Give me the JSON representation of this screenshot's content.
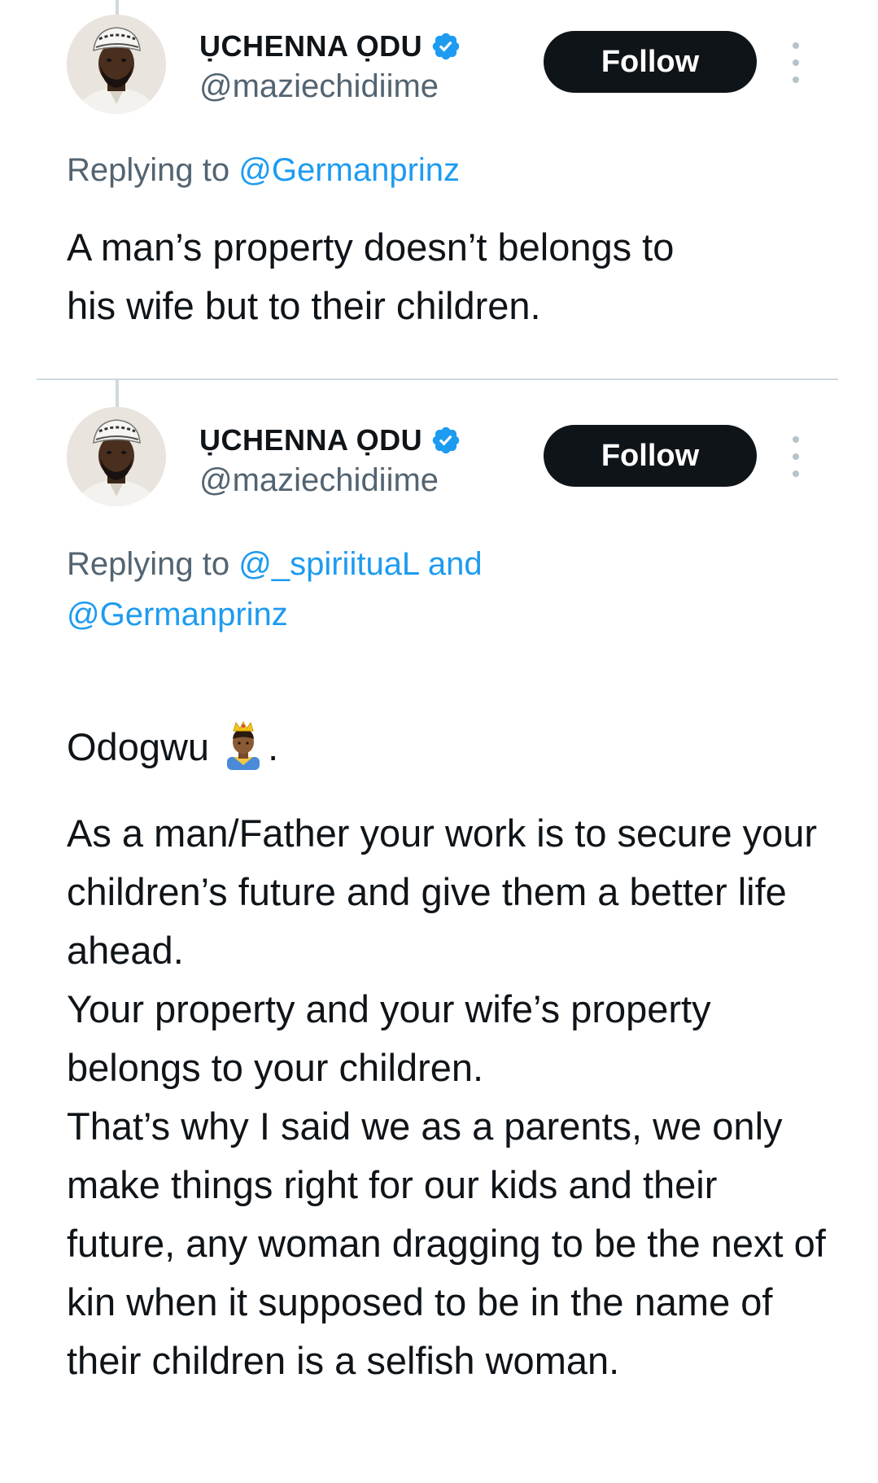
{
  "tweets": [
    {
      "author": {
        "display_name": "ỤCHENNA ỌDU",
        "handle": "@maziechidiime",
        "verified": true,
        "avatar_icon": "profile-photo-man-with-cap"
      },
      "follow_label": "Follow",
      "more_icon": "vertical-ellipsis-icon",
      "replying_prefix": "Replying to",
      "replying_to": [
        "@Germanprinz"
      ],
      "text": "A man’s property doesn’t belongs to his wife but to their children."
    },
    {
      "author": {
        "display_name": "ỤCHENNA ỌDU",
        "handle": "@maziechidiime",
        "verified": true,
        "avatar_icon": "profile-photo-man-with-cap"
      },
      "follow_label": "Follow",
      "more_icon": "vertical-ellipsis-icon",
      "replying_prefix": "Replying to",
      "replying_to": [
        "@_spiriituaL",
        "and",
        "@Germanprinz"
      ],
      "text_lead": "Odogwu",
      "text_lead_emoji": "prince-emoji",
      "text_lead_after": ".",
      "text_body": "As a man/Father your work is to secure your children’s future and give them a better life ahead.\nYour property and your wife’s property belongs to your children.\nThat’s why I said we as a parents, we only make things right for our kids and their future, any woman dragging to be the next of kin when it supposed to be in the name of their children is a selfish woman."
    }
  ],
  "colors": {
    "text_primary": "#0f1419",
    "text_secondary": "#536471",
    "link": "#1d9bf0",
    "verified_badge": "#1d9bf0",
    "follow_button_bg": "#0f1419",
    "divider": "#cfd9de"
  }
}
